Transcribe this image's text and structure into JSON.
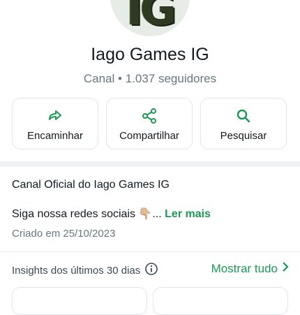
{
  "avatar": {
    "logo_text": "IG"
  },
  "channel": {
    "name": "Iago Games IG",
    "subtitle": "Canal • 1.037 seguidores"
  },
  "actions": [
    {
      "label": "Encaminhar",
      "icon": "forward-icon"
    },
    {
      "label": "Compartilhar",
      "icon": "share-icon"
    },
    {
      "label": "Pesquisar",
      "icon": "search-icon"
    }
  ],
  "description": {
    "title_line": "Canal Oficial do Iago Games IG",
    "social_line": "Siga nossa redes sociais 👇🏼...",
    "read_more": "Ler mais",
    "created": "Criado em 25/10/2023"
  },
  "insights": {
    "label": "Insights dos últimos 30 dias",
    "show_all": "Mostrar tudo"
  },
  "colors": {
    "accent": "#1a9a54",
    "muted": "#667781",
    "border": "#e3e6e8"
  }
}
